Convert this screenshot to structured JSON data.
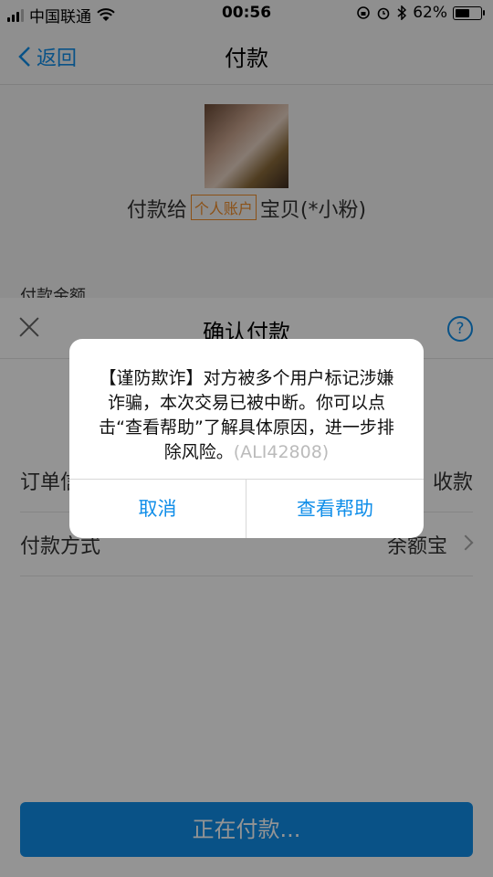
{
  "status_bar": {
    "carrier": "中国联通",
    "time": "00:56",
    "battery_percent": "62%",
    "battery_level": 0.62
  },
  "nav": {
    "back_label": "返回",
    "title": "付款"
  },
  "payee": {
    "prefix": "付款给",
    "tag": "个人账户",
    "name": "宝贝(*小粉)"
  },
  "amount_label": "付款金额",
  "sheet": {
    "title": "确认付款",
    "help_icon_text": "?",
    "rows": [
      {
        "label": "订单信息",
        "value": "收款"
      },
      {
        "label": "付款方式",
        "value": "余额宝"
      }
    ],
    "pay_button": "正在付款..."
  },
  "alert": {
    "message": "【谨防欺诈】对方被多个用户标记涉嫌诈骗，本次交易已被中断。你可以点击“查看帮助”了解具体原因，进一步排除风险。",
    "code": "(ALI42808)",
    "cancel": "取消",
    "help": "查看帮助"
  },
  "colors": {
    "accent": "#108ee9",
    "tag": "#f08c28"
  }
}
